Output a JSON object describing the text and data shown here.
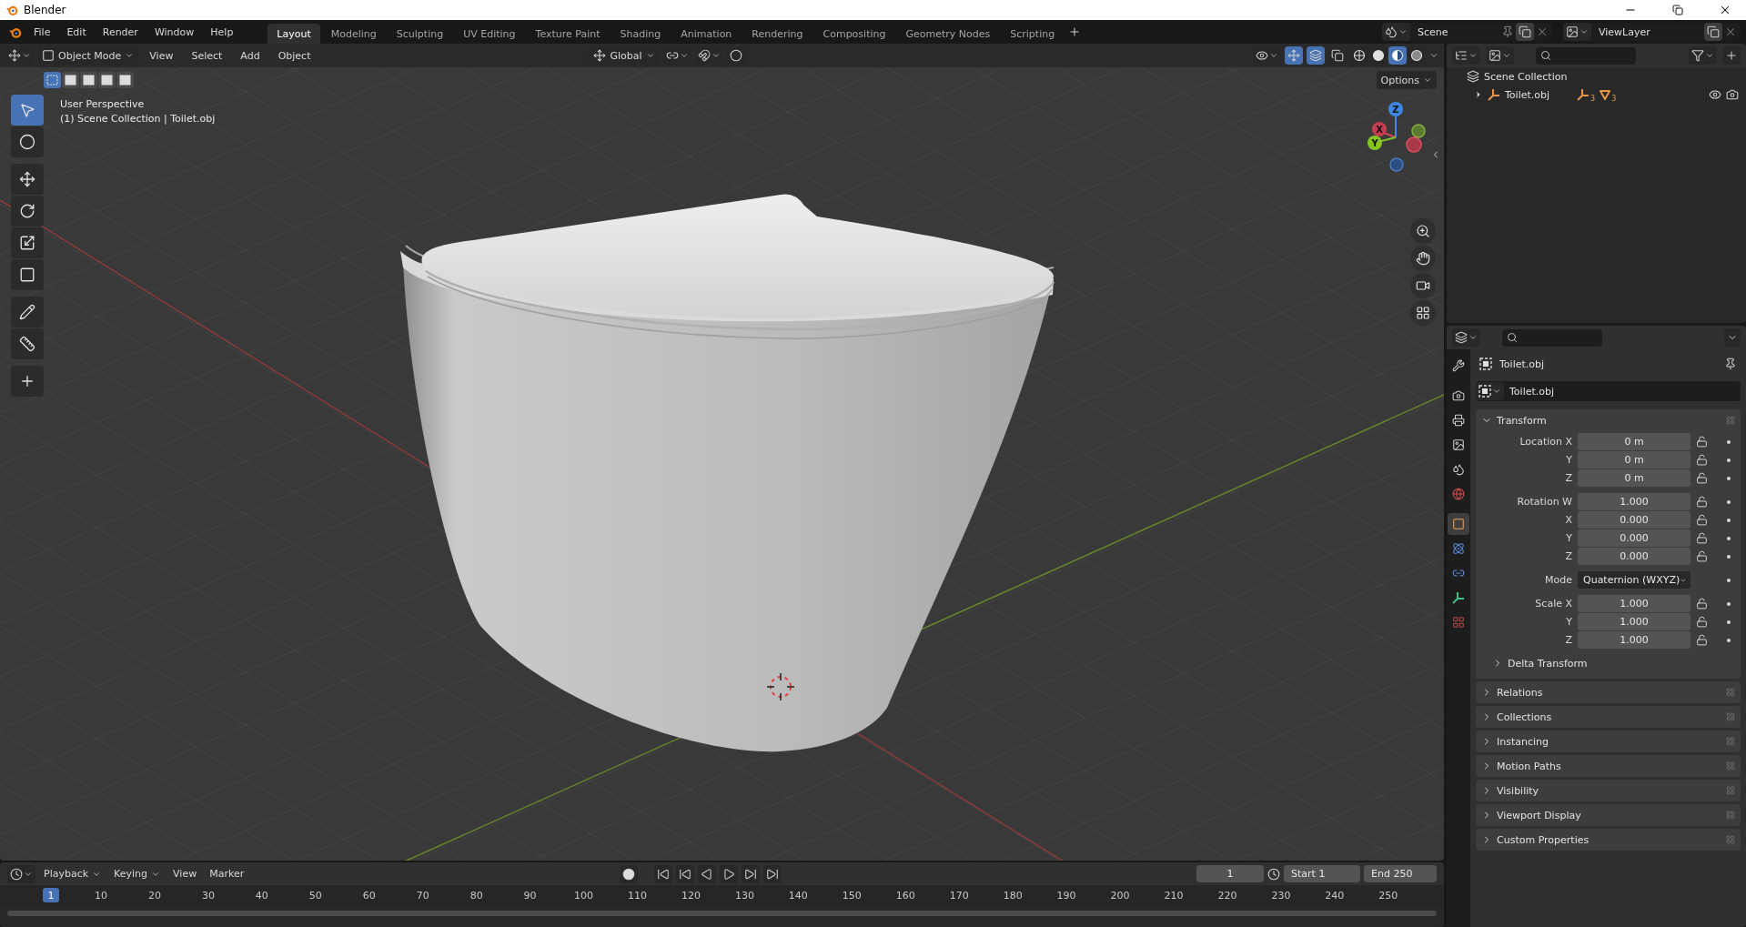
{
  "window": {
    "title": "Blender"
  },
  "menus": [
    "File",
    "Edit",
    "Render",
    "Window",
    "Help"
  ],
  "workspaces": [
    {
      "label": "Layout",
      "selected": true
    },
    {
      "label": "Modeling",
      "selected": false
    },
    {
      "label": "Sculpting",
      "selected": false
    },
    {
      "label": "UV Editing",
      "selected": false
    },
    {
      "label": "Texture Paint",
      "selected": false
    },
    {
      "label": "Shading",
      "selected": false
    },
    {
      "label": "Animation",
      "selected": false
    },
    {
      "label": "Rendering",
      "selected": false
    },
    {
      "label": "Compositing",
      "selected": false
    },
    {
      "label": "Geometry Nodes",
      "selected": false
    },
    {
      "label": "Scripting",
      "selected": false
    }
  ],
  "scene": {
    "name": "Scene"
  },
  "view_layer": {
    "name": "ViewLayer"
  },
  "viewport": {
    "mode": "Object Mode",
    "menus": [
      "View",
      "Select",
      "Add",
      "Object"
    ],
    "orientation": "Global",
    "options": "Options",
    "select_modes": [
      {
        "selected": true
      },
      {
        "selected": false
      },
      {
        "selected": false
      },
      {
        "selected": false
      },
      {
        "selected": false
      }
    ],
    "toggles": [
      {
        "kind": "gizmo",
        "on": true
      },
      {
        "kind": "overlay",
        "on": true
      },
      {
        "kind": "xray",
        "on": false
      }
    ],
    "shading": [
      {
        "selected": false
      },
      {
        "selected": false
      },
      {
        "selected": true
      },
      {
        "selected": false
      }
    ],
    "overlay_lines": [
      "User Perspective",
      "(1) Scene Collection | Toilet.obj"
    ],
    "tools": [
      {
        "selected": true
      },
      {
        "selected": false
      },
      {
        "selected": false
      },
      {
        "selected": false
      },
      {
        "selected": false
      },
      {
        "selected": false
      },
      {
        "selected": false
      },
      {
        "selected": false
      },
      {
        "selected": false
      }
    ],
    "gizmo": {
      "x": "X",
      "y": "Y",
      "z": "Z"
    }
  },
  "outliner": {
    "root": "Scene Collection",
    "items": [
      {
        "name": "Toilet.obj",
        "expanded": false,
        "modifier_count": "3",
        "mesh_count": "3",
        "visible": true
      }
    ]
  },
  "properties": {
    "tabs": [
      {
        "selected": false
      },
      {
        "selected": false
      },
      {
        "selected": false
      },
      {
        "selected": false
      },
      {
        "selected": false
      },
      {
        "selected": false
      },
      {
        "selected": true
      },
      {
        "selected": false
      },
      {
        "selected": false
      },
      {
        "selected": false
      },
      {
        "selected": false
      }
    ],
    "object_name": "Toilet.obj",
    "data_name": "Toilet.obj",
    "panels": [
      {
        "title": "Transform",
        "expanded": true,
        "groups": [
          [
            {
              "label": "Location X",
              "kind": "number",
              "value": "0 m"
            },
            {
              "label": "Y",
              "kind": "number",
              "value": "0 m"
            },
            {
              "label": "Z",
              "kind": "number",
              "value": "0 m"
            }
          ],
          [
            {
              "label": "Rotation W",
              "kind": "number",
              "value": "1.000"
            },
            {
              "label": "X",
              "kind": "number",
              "value": "0.000"
            },
            {
              "label": "Y",
              "kind": "number",
              "value": "0.000"
            },
            {
              "label": "Z",
              "kind": "number",
              "value": "0.000"
            }
          ],
          [
            {
              "label": "Mode",
              "kind": "select",
              "value": "Quaternion (WXYZ)"
            }
          ],
          [
            {
              "label": "Scale X",
              "kind": "number",
              "value": "1.000"
            },
            {
              "label": "Y",
              "kind": "number",
              "value": "1.000"
            },
            {
              "label": "Z",
              "kind": "number",
              "value": "1.000"
            }
          ]
        ],
        "subpanels": [
          {
            "title": "Delta Transform",
            "expanded": false
          }
        ]
      },
      {
        "title": "Relations",
        "expanded": false
      },
      {
        "title": "Collections",
        "expanded": false
      },
      {
        "title": "Instancing",
        "expanded": false
      },
      {
        "title": "Motion Paths",
        "expanded": false
      },
      {
        "title": "Visibility",
        "expanded": false
      },
      {
        "title": "Viewport Display",
        "expanded": false
      },
      {
        "title": "Custom Properties",
        "expanded": false
      }
    ]
  },
  "timeline": {
    "menus": [
      "Playback",
      "Keying",
      "View",
      "Marker"
    ],
    "current_frame": "1",
    "start_label": "Start",
    "start": "1",
    "end_label": "End",
    "end": "250",
    "playhead": "1",
    "ruler": [
      "10",
      "20",
      "30",
      "40",
      "50",
      "60",
      "70",
      "80",
      "90",
      "100",
      "110",
      "120",
      "130",
      "140",
      "150",
      "160",
      "170",
      "180",
      "190",
      "200",
      "210",
      "220",
      "230",
      "240",
      "250"
    ]
  }
}
